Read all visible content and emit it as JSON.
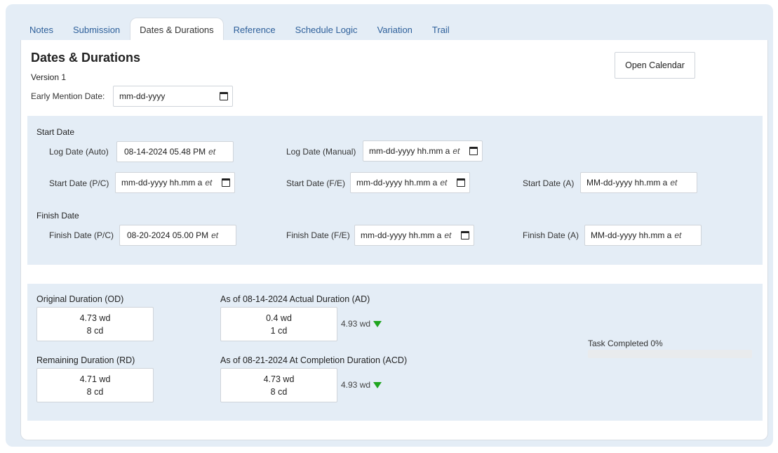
{
  "tabs": [
    {
      "label": "Notes",
      "active": false
    },
    {
      "label": "Submission",
      "active": false
    },
    {
      "label": "Dates & Durations",
      "active": true
    },
    {
      "label": "Reference",
      "active": false
    },
    {
      "label": "Schedule Logic",
      "active": false
    },
    {
      "label": "Variation",
      "active": false
    },
    {
      "label": "Trail",
      "active": false
    }
  ],
  "header": {
    "title": "Dates & Durations",
    "version": "Version 1",
    "open_calendar_label": "Open Calendar",
    "early_mention_label": "Early Mention Date:",
    "early_mention_value": "mm-dd-yyyy"
  },
  "start_section": {
    "title": "Start Date",
    "log_auto_label": "Log Date (Auto)",
    "log_auto_value": "08-14-2024 05.48 PM",
    "log_manual_label": "Log Date (Manual)",
    "log_manual_value": "mm-dd-yyyy hh.mm a",
    "start_pc_label": "Start Date (P/C)",
    "start_pc_value": "mm-dd-yyyy hh.mm a",
    "start_fe_label": "Start Date (F/E)",
    "start_fe_value": "mm-dd-yyyy hh.mm a",
    "start_a_label": "Start Date (A)",
    "start_a_value": "MM-dd-yyyy hh.mm a"
  },
  "finish_section": {
    "title": "Finish Date",
    "finish_pc_label": "Finish Date (P/C)",
    "finish_pc_value": "08-20-2024 05.00 PM",
    "finish_fe_label": "Finish Date (F/E)",
    "finish_fe_value": "mm-dd-yyyy hh.mm a",
    "finish_a_label": "Finish Date (A)",
    "finish_a_value": "MM-dd-yyyy hh.mm a"
  },
  "timezone": "et",
  "durations": {
    "od_label": "Original Duration (OD)",
    "od_wd": "4.73 wd",
    "od_cd": "8 cd",
    "ad_label": "As of 08-14-2024 Actual Duration (AD)",
    "ad_wd": "0.4 wd",
    "ad_cd": "1 cd",
    "ad_delta": "4.93 wd",
    "rd_label": "Remaining Duration (RD)",
    "rd_wd": "4.71 wd",
    "rd_cd": "8 cd",
    "acd_label": "As of 08-21-2024 At Completion Duration (ACD)",
    "acd_wd": "4.73 wd",
    "acd_cd": "8 cd",
    "acd_delta": "4.93 wd",
    "delta_color": "#1fa51f"
  },
  "progress": {
    "label": "Task Completed 0%",
    "percent": 0
  },
  "colors": {
    "accent": "#2d5f9a",
    "background": "#e4edf6"
  }
}
